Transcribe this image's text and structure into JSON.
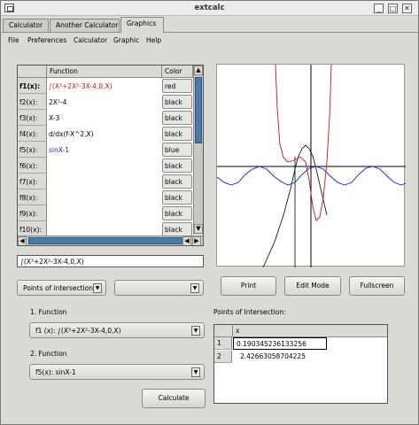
{
  "window": {
    "title": "extcalc",
    "minimize": "_",
    "maximize": "□",
    "close": "✕"
  },
  "tabs": [
    {
      "label": "Calculator"
    },
    {
      "label": "Another Calculator"
    },
    {
      "label": "Graphics"
    }
  ],
  "menu": [
    "File",
    "Preferences",
    "Calculator",
    "Graphic",
    "Help"
  ],
  "function_table": {
    "col_function": "Function",
    "col_color": "Color",
    "rows": [
      {
        "label": "f1(x):",
        "formula": "∫(X³+2X²-3X-4,0,X)",
        "color": "red",
        "text_color": "#c01818"
      },
      {
        "label": "f2(x):",
        "formula": "2X²-4",
        "color": "black",
        "text_color": "#000000"
      },
      {
        "label": "f3(x):",
        "formula": "X-3",
        "color": "black",
        "text_color": "#000000"
      },
      {
        "label": "f4(x):",
        "formula": "d/dx(f-X^2,X)",
        "color": "black",
        "text_color": "#000000"
      },
      {
        "label": "f5(x):",
        "formula": "sinX-1",
        "color": "blue",
        "text_color": "#1c1cc0"
      },
      {
        "label": "f6(x):",
        "formula": "",
        "color": "black",
        "text_color": "#000000"
      },
      {
        "label": "f7(x):",
        "formula": "",
        "color": "black",
        "text_color": "#000000"
      },
      {
        "label": "f8(x):",
        "formula": "",
        "color": "black",
        "text_color": "#000000"
      },
      {
        "label": "f9(x):",
        "formula": "",
        "color": "black",
        "text_color": "#000000"
      },
      {
        "label": "f10(x):",
        "formula": "",
        "color": "black",
        "text_color": "#000000"
      }
    ]
  },
  "formula_field": {
    "value": "∫(X³+2X²-3X-4,0,X)"
  },
  "analysis": {
    "mode": "Points of intersection",
    "second_combo": "",
    "function1_label": "1. Function",
    "function1_value": "f1 (x): ∫(X³+2X²-3X-4,0,X)",
    "function2_label": "2. Function",
    "function2_value": "f5(x): sinX-1",
    "calculate": "Calculate"
  },
  "plot_buttons": {
    "print": "Print",
    "edit_mode": "Edit Mode",
    "fullscreen": "Fullscreen"
  },
  "intersections": {
    "title": "Points of Intersection:",
    "column": "x",
    "rows": [
      {
        "index": "1",
        "x": "0.190345236133256"
      },
      {
        "index": "2",
        "x": "2.42663058704225"
      }
    ]
  },
  "colors": {
    "accent": "#4a7ba7",
    "f1": "#c01818",
    "f5": "#1c1cc0"
  }
}
